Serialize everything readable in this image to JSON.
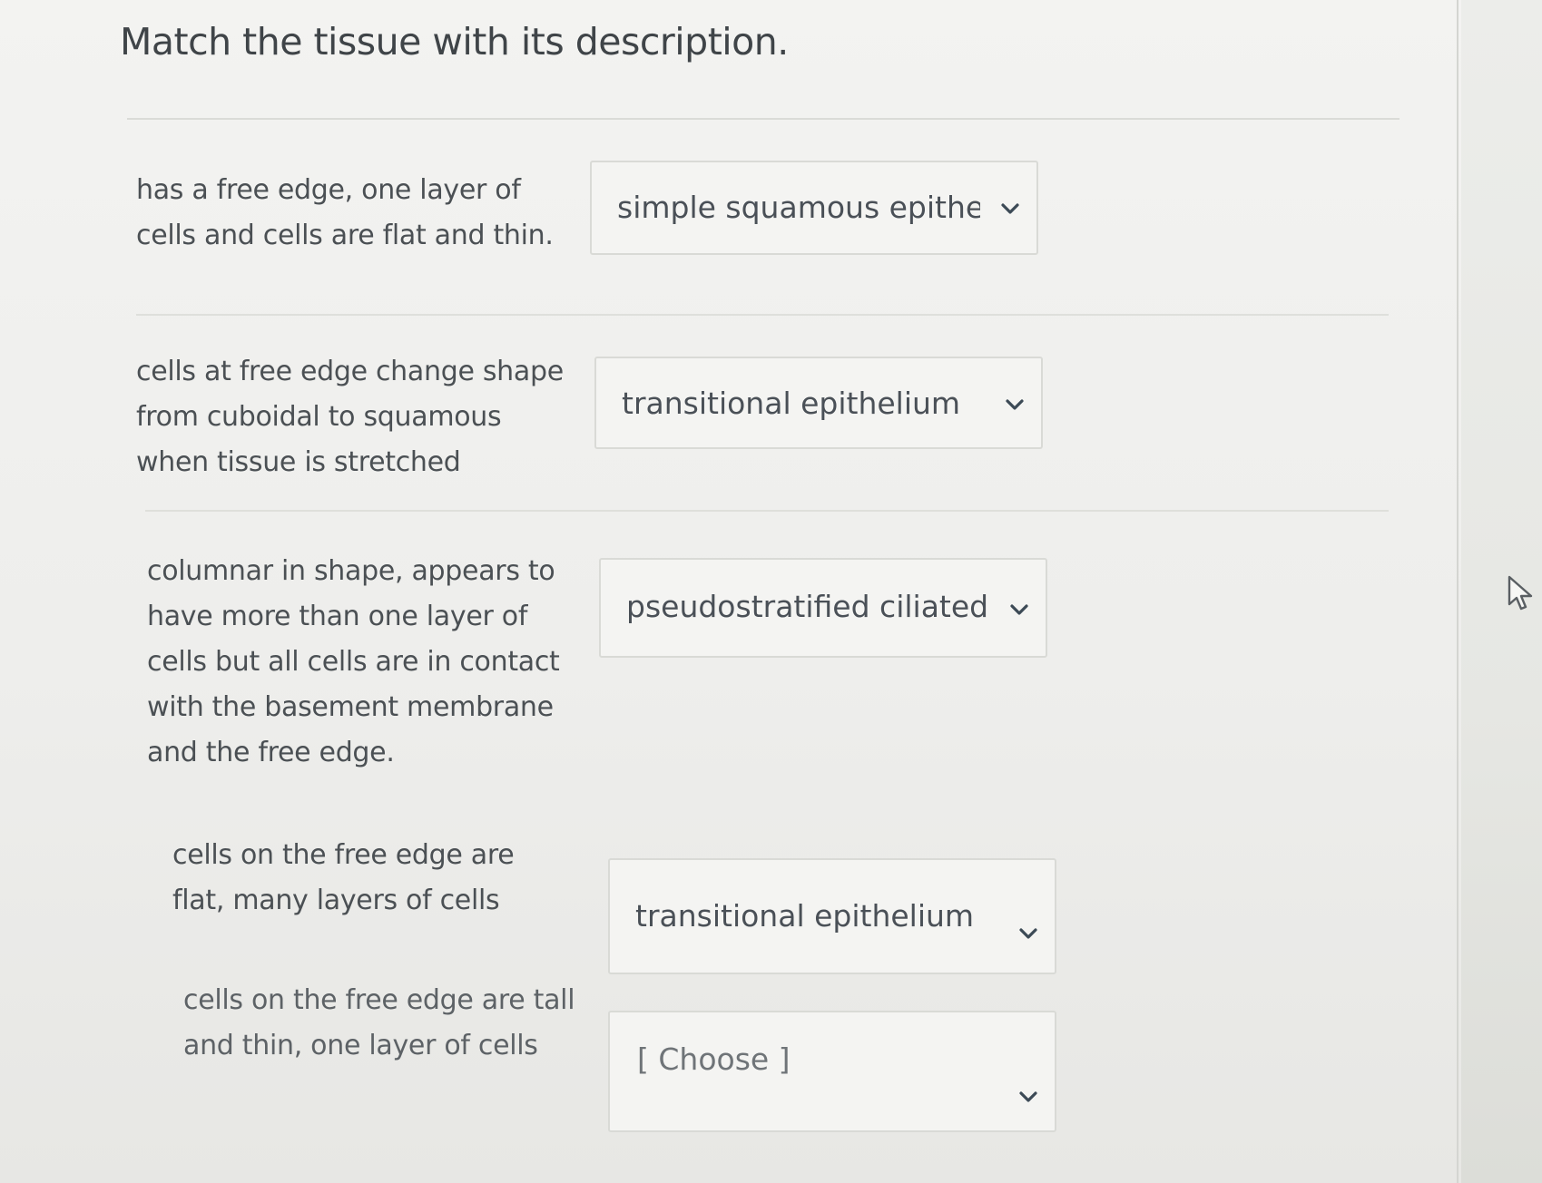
{
  "question": {
    "title": "Match the tissue with its description."
  },
  "rows": [
    {
      "prompt": "has a free edge, one layer of cells and cells are flat and thin.",
      "selected": "simple squamous epitheli"
    },
    {
      "prompt": "cells at free edge change shape from cuboidal to squamous when tissue is stretched",
      "selected": "transitional epithelium"
    },
    {
      "prompt": "columnar in shape, appears to have more than one layer of cells but all cells are in contact with the basement membrane and the free edge.",
      "selected": "pseudostratified ciliated"
    },
    {
      "prompt": "cells on the free edge are flat, many layers of cells",
      "selected": "transitional epithelium"
    },
    {
      "prompt": "cells on the free edge are tall and thin, one layer of cells",
      "selected": "[ Choose ]"
    }
  ],
  "icons": {
    "dropdown": "chevron-down-icon",
    "cursor": "mouse-pointer-icon"
  },
  "colors": {
    "text": "#4b5054",
    "border": "#d9dad6",
    "chevron": "#3c4a56"
  }
}
